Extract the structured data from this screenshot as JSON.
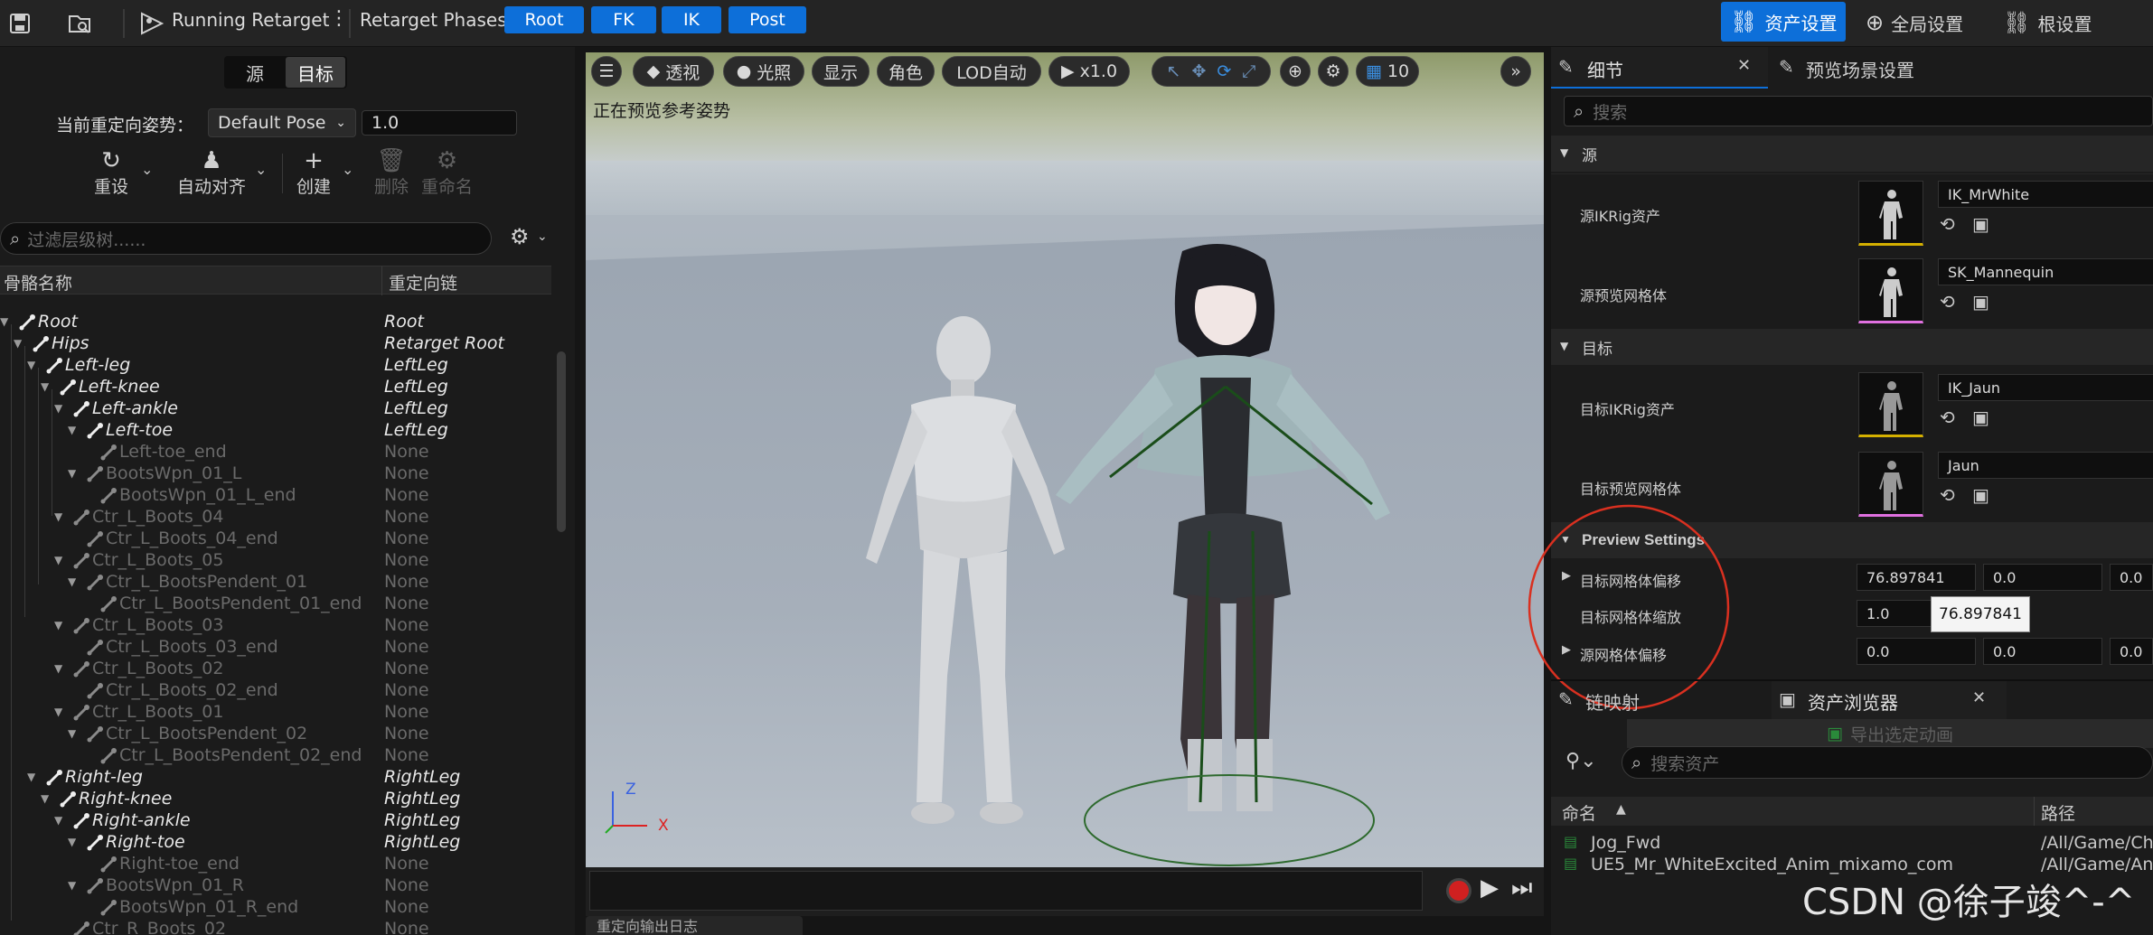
{
  "toolbar": {
    "running_label": "Running Retarget",
    "phases_label": "Retarget Phases:",
    "phases": [
      "Root",
      "FK",
      "IK",
      "Post"
    ],
    "right_buttons": [
      "资产设置",
      "全局设置",
      "根设置"
    ]
  },
  "left": {
    "seg_source": "源",
    "seg_target": "目标",
    "pose_label": "当前重定向姿势：",
    "pose_value": "Default Pose",
    "pose_number": "1.0",
    "tools": [
      "重设",
      "自动对齐",
      "创建",
      "删除",
      "重命名"
    ],
    "filter_placeholder": "过滤层级树......",
    "col_bone": "骨骼名称",
    "col_chain": "重定向链",
    "rows": [
      {
        "name": "Root",
        "chain": "Root",
        "depth": 0,
        "hi": true
      },
      {
        "name": "Hips",
        "chain": "Retarget Root",
        "depth": 1,
        "hi": true
      },
      {
        "name": "Left-leg",
        "chain": "LeftLeg",
        "depth": 2,
        "hi": true
      },
      {
        "name": "Left-knee",
        "chain": "LeftLeg",
        "depth": 3,
        "hi": true
      },
      {
        "name": "Left-ankle",
        "chain": "LeftLeg",
        "depth": 4,
        "hi": true
      },
      {
        "name": "Left-toe",
        "chain": "LeftLeg",
        "depth": 5,
        "hi": true
      },
      {
        "name": "Left-toe_end",
        "chain": "None",
        "depth": 6,
        "hi": false
      },
      {
        "name": "BootsWpn_01_L",
        "chain": "None",
        "depth": 5,
        "hi": false
      },
      {
        "name": "BootsWpn_01_L_end",
        "chain": "None",
        "depth": 6,
        "hi": false
      },
      {
        "name": "Ctr_L_Boots_04",
        "chain": "None",
        "depth": 4,
        "hi": false
      },
      {
        "name": "Ctr_L_Boots_04_end",
        "chain": "None",
        "depth": 5,
        "hi": false
      },
      {
        "name": "Ctr_L_Boots_05",
        "chain": "None",
        "depth": 4,
        "hi": false
      },
      {
        "name": "Ctr_L_BootsPendent_01",
        "chain": "None",
        "depth": 5,
        "hi": false
      },
      {
        "name": "Ctr_L_BootsPendent_01_end",
        "chain": "None",
        "depth": 6,
        "hi": false
      },
      {
        "name": "Ctr_L_Boots_03",
        "chain": "None",
        "depth": 4,
        "hi": false
      },
      {
        "name": "Ctr_L_Boots_03_end",
        "chain": "None",
        "depth": 5,
        "hi": false
      },
      {
        "name": "Ctr_L_Boots_02",
        "chain": "None",
        "depth": 4,
        "hi": false
      },
      {
        "name": "Ctr_L_Boots_02_end",
        "chain": "None",
        "depth": 5,
        "hi": false
      },
      {
        "name": "Ctr_L_Boots_01",
        "chain": "None",
        "depth": 4,
        "hi": false
      },
      {
        "name": "Ctr_L_BootsPendent_02",
        "chain": "None",
        "depth": 5,
        "hi": false
      },
      {
        "name": "Ctr_L_BootsPendent_02_end",
        "chain": "None",
        "depth": 6,
        "hi": false
      },
      {
        "name": "Right-leg",
        "chain": "RightLeg",
        "depth": 2,
        "hi": true
      },
      {
        "name": "Right-knee",
        "chain": "RightLeg",
        "depth": 3,
        "hi": true
      },
      {
        "name": "Right-ankle",
        "chain": "RightLeg",
        "depth": 4,
        "hi": true
      },
      {
        "name": "Right-toe",
        "chain": "RightLeg",
        "depth": 5,
        "hi": true
      },
      {
        "name": "Right-toe_end",
        "chain": "None",
        "depth": 6,
        "hi": false
      },
      {
        "name": "BootsWpn_01_R",
        "chain": "None",
        "depth": 5,
        "hi": false
      },
      {
        "name": "BootsWpn_01_R_end",
        "chain": "None",
        "depth": 6,
        "hi": false
      },
      {
        "name": "Ctr_R_Boots_02",
        "chain": "None",
        "depth": 4,
        "hi": false
      }
    ]
  },
  "viewport": {
    "btn_persp": "透视",
    "btn_light": "光照",
    "btn_show": "显示",
    "btn_char": "角色",
    "btn_lod": "LOD自动",
    "btn_speed": "x1.0",
    "btn_grid": "10",
    "status": "正在预览参考姿势",
    "axis_x": "X",
    "axis_z": "Z"
  },
  "details": {
    "tab_details": "细节",
    "tab_preview": "预览场景设置",
    "search_placeholder": "搜索",
    "sec_source": "源",
    "src_ikrig_label": "源IKRig资产",
    "src_ikrig_value": "IK_MrWhite",
    "src_mesh_label": "源预览网格体",
    "src_mesh_value": "SK_Mannequin",
    "sec_target": "目标",
    "tgt_ikrig_label": "目标IKRig资产",
    "tgt_ikrig_value": "IK_Jaun",
    "tgt_mesh_label": "目标预览网格体",
    "tgt_mesh_value": "Jaun",
    "sec_preview": "Preview Settings",
    "offset_label": "目标网格体偏移",
    "offset_x": "76.897841",
    "offset_y": "0.0",
    "offset_z": "0.0",
    "scale_label": "目标网格体缩放",
    "scale_value": "1.0",
    "tooltip": "76.897841",
    "src_offset_label": "源网格体偏移",
    "src_offset_x": "0.0",
    "src_offset_y": "0.0",
    "src_offset_z": "0.0"
  },
  "bottom": {
    "tab_chain": "链映射",
    "tab_assets": "资产浏览器",
    "export_btn": "导出选定动画",
    "search_placeholder": "搜索资产",
    "col_name": "命名",
    "col_path": "路径",
    "assets": [
      {
        "name": "Jog_Fwd",
        "path": "/All/Game/Ch"
      },
      {
        "name": "UE5_Mr_WhiteExcited_Anim_mixamo_com",
        "path": "/All/Game/An"
      }
    ],
    "output_tab": "重定向输出日志"
  },
  "watermark": "CSDN @徐子竣^-^"
}
